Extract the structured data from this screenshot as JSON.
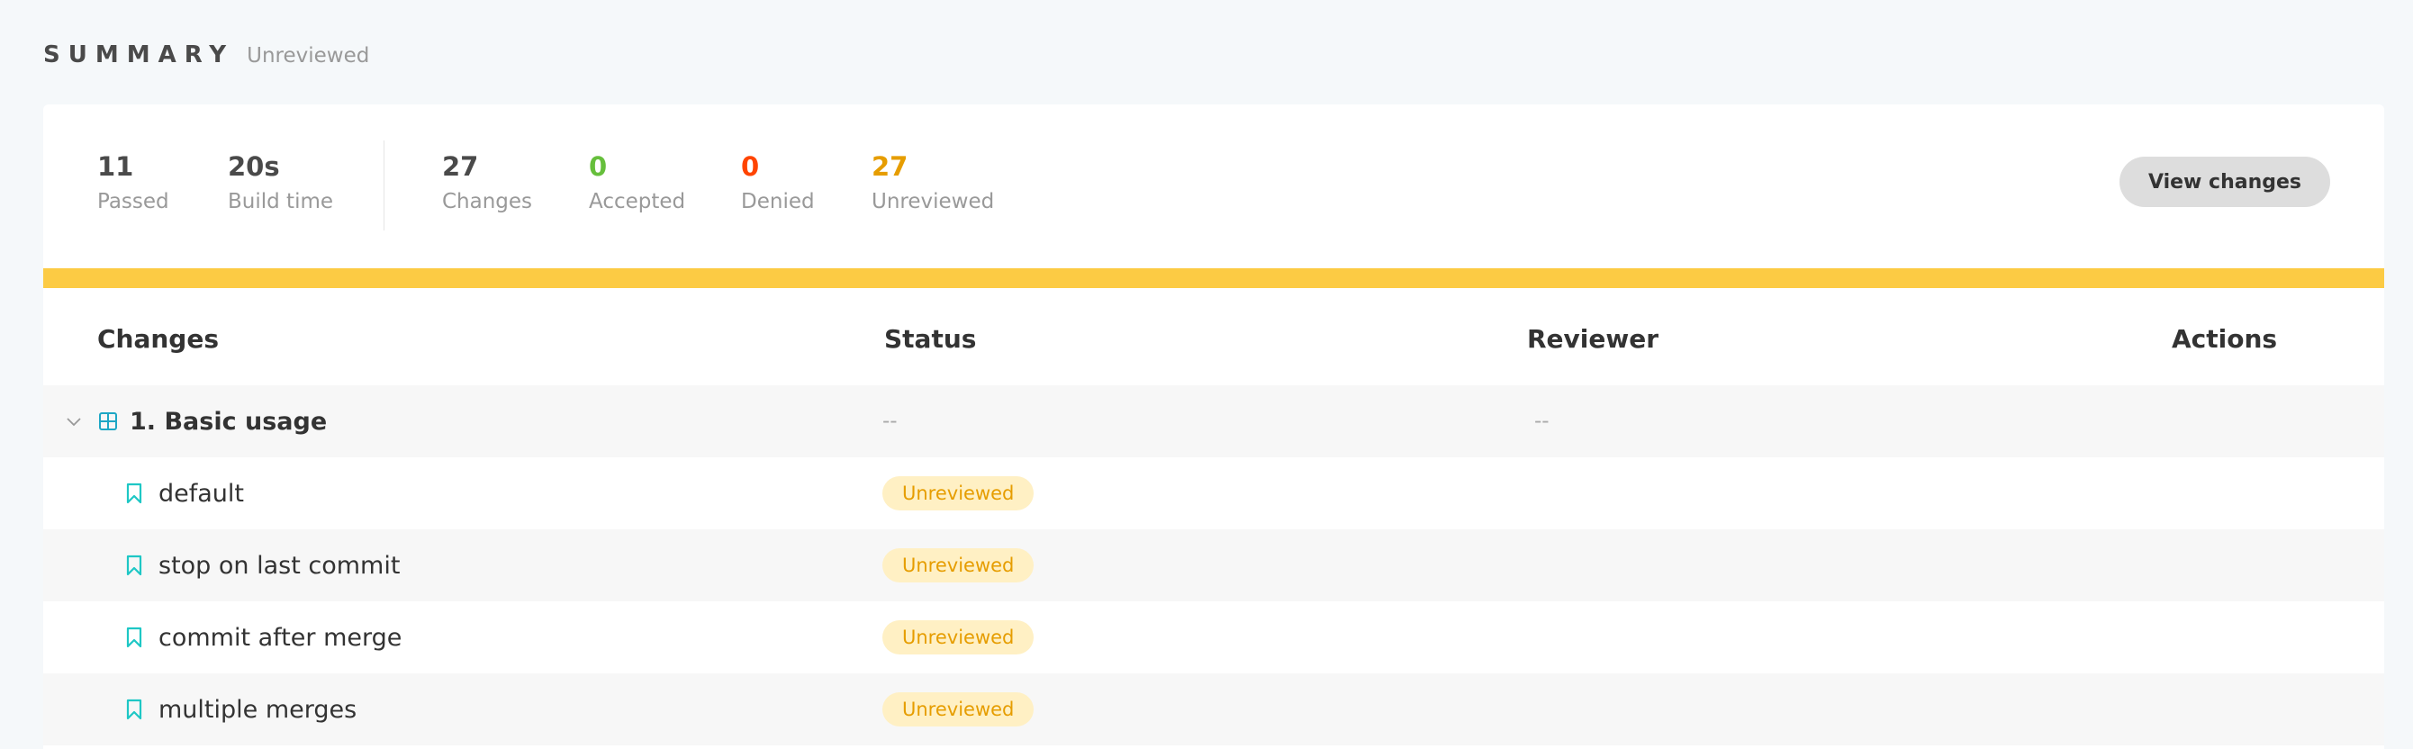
{
  "header": {
    "title": "SUMMARY",
    "status": "Unreviewed"
  },
  "stats": {
    "passed": {
      "value": "11",
      "label": "Passed"
    },
    "build_time": {
      "value": "20s",
      "label": "Build time"
    },
    "changes": {
      "value": "27",
      "label": "Changes"
    },
    "accepted": {
      "value": "0",
      "label": "Accepted"
    },
    "denied": {
      "value": "0",
      "label": "Denied"
    },
    "unreviewed": {
      "value": "27",
      "label": "Unreviewed"
    }
  },
  "actions": {
    "view_changes_label": "View changes"
  },
  "progress": {
    "unreviewed_fraction": 1.0,
    "color": "#fccb44"
  },
  "table": {
    "columns": {
      "changes": "Changes",
      "status": "Status",
      "reviewer": "Reviewer",
      "actions": "Actions"
    },
    "group": {
      "name": "1. Basic usage",
      "status": "--",
      "reviewer": "--",
      "icons": {
        "toggle": "chevron-down-icon",
        "type": "grid-icon"
      }
    },
    "rows": [
      {
        "name": "default",
        "status": "Unreviewed",
        "icon": "bookmark-icon"
      },
      {
        "name": "stop on last commit",
        "status": "Unreviewed",
        "icon": "bookmark-icon"
      },
      {
        "name": "commit after merge",
        "status": "Unreviewed",
        "icon": "bookmark-icon"
      },
      {
        "name": "multiple merges",
        "status": "Unreviewed",
        "icon": "bookmark-icon"
      }
    ]
  },
  "colors": {
    "accepted": "#66bf3c",
    "denied": "#ff4400",
    "unreviewed": "#e69d00",
    "badge_bg": "#fff0c4",
    "icon_teal": "#1ea7c5"
  }
}
